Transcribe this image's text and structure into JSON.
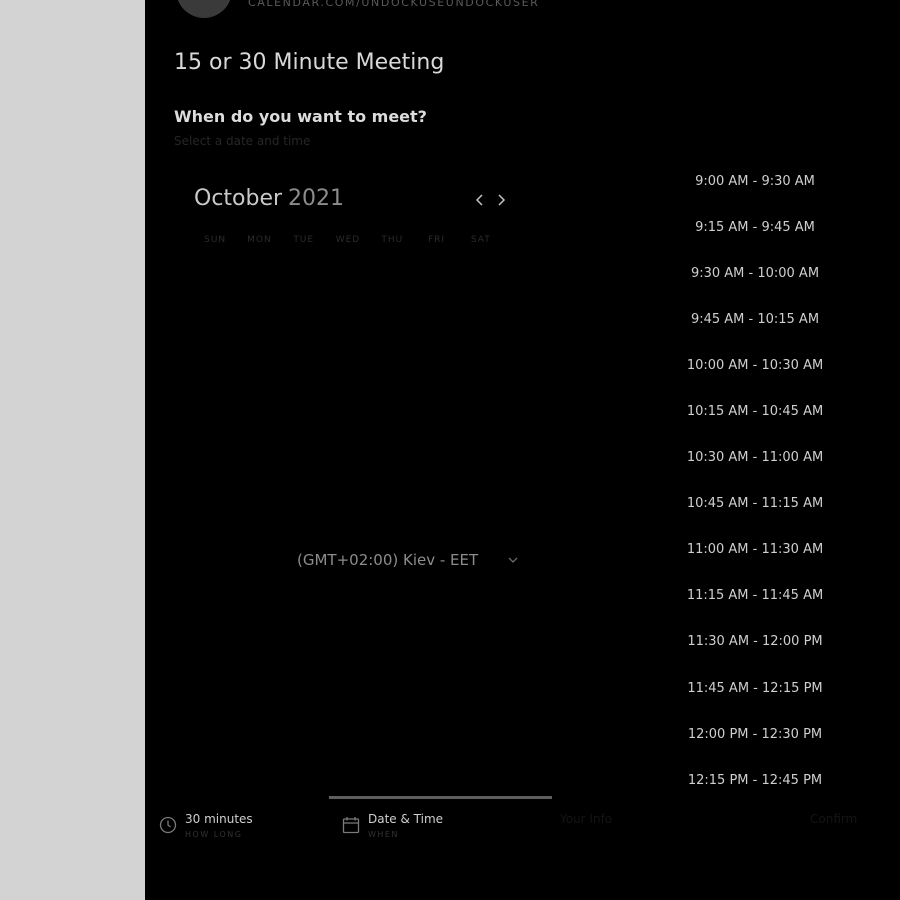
{
  "header": {
    "calendar_url": "CALENDAR.COM/UNDOCKUSEUNDOCKUSER",
    "title": "15 or 30 Minute Meeting",
    "question": "When do you want to meet?",
    "subtext": "Select a date and time"
  },
  "calendar": {
    "month": "October",
    "year": "2021",
    "weekdays": [
      "SUN",
      "MON",
      "TUE",
      "WED",
      "THU",
      "FRI",
      "SAT"
    ]
  },
  "timezone": {
    "label": "(GMT+02:00) Kiev - EET"
  },
  "time_slots": [
    "9:00 AM - 9:30 AM",
    "9:15 AM - 9:45 AM",
    "9:30 AM - 10:00 AM",
    "9:45 AM - 10:15 AM",
    "10:00 AM - 10:30 AM",
    "10:15 AM - 10:45 AM",
    "10:30 AM - 11:00 AM",
    "10:45 AM - 11:15 AM",
    "11:00 AM - 11:30 AM",
    "11:15 AM - 11:45 AM",
    "11:30 AM - 12:00 PM",
    "11:45 AM - 12:15 PM",
    "12:00 PM - 12:30 PM",
    "12:15 PM - 12:45 PM"
  ],
  "steps": {
    "duration": {
      "label": "30 minutes",
      "sub": "HOW LONG"
    },
    "datetime": {
      "label": "Date & Time",
      "sub": "WHEN"
    },
    "step3": {
      "label": "Your Info"
    },
    "step4": {
      "label": "Confirm"
    }
  },
  "icons": {
    "prev": "chevron-left-icon",
    "next": "chevron-right-icon",
    "timezone_caret": "chevron-down-icon",
    "duration": "clock-icon",
    "datetime": "calendar-icon"
  }
}
